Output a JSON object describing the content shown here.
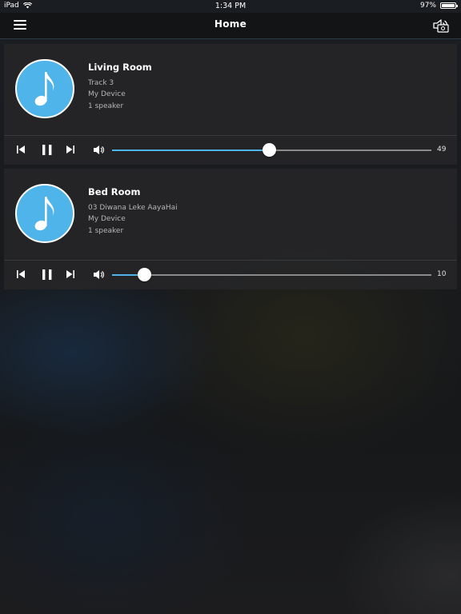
{
  "status_bar": {
    "device": "iPad",
    "time": "1:34 PM",
    "battery": "97%",
    "battery_level": 0.97
  },
  "nav": {
    "title": "Home",
    "menu_icon": "hamburger-menu-icon",
    "speaker_icon": "speaker-group-icon"
  },
  "colors": {
    "accent": "#4fb4ea",
    "card_bg": "#262628",
    "nav_bg": "#131416"
  },
  "rooms": [
    {
      "name": "Living Room",
      "track": "Track 3",
      "device": "My Device",
      "speakers": "1 speaker",
      "volume": 49,
      "volume_label": "49"
    },
    {
      "name": "Bed Room",
      "track": "03 Diwana Leke AayaHai",
      "device": "My Device",
      "speakers": "1 speaker",
      "volume": 10,
      "volume_label": "10"
    }
  ]
}
